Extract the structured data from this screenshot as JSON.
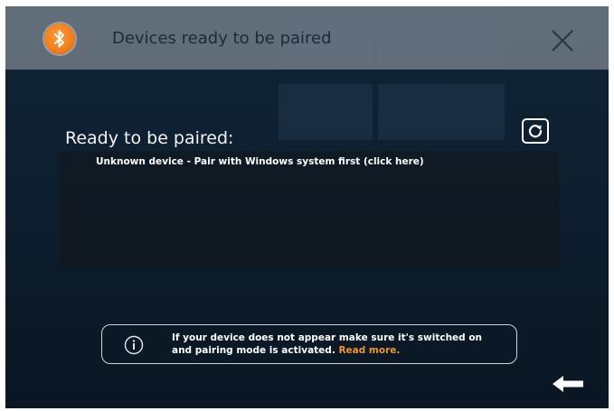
{
  "header": {
    "title": "Devices ready to be paired",
    "icon": "bluetooth-icon",
    "accent_color": "#f07e1a"
  },
  "main": {
    "section_title": "Ready to be paired:",
    "devices": [
      {
        "label": "Unknown device - Pair with Windows system first (click here)"
      }
    ]
  },
  "info": {
    "line1": "If your device does not appear make sure it's switched on",
    "line2": "and pairing mode is activated.",
    "link": "Read more.",
    "link_color": "#f0962a"
  },
  "icons": {
    "close": "close-icon",
    "refresh": "refresh-icon",
    "info": "info-icon",
    "back": "back-arrow-icon"
  }
}
